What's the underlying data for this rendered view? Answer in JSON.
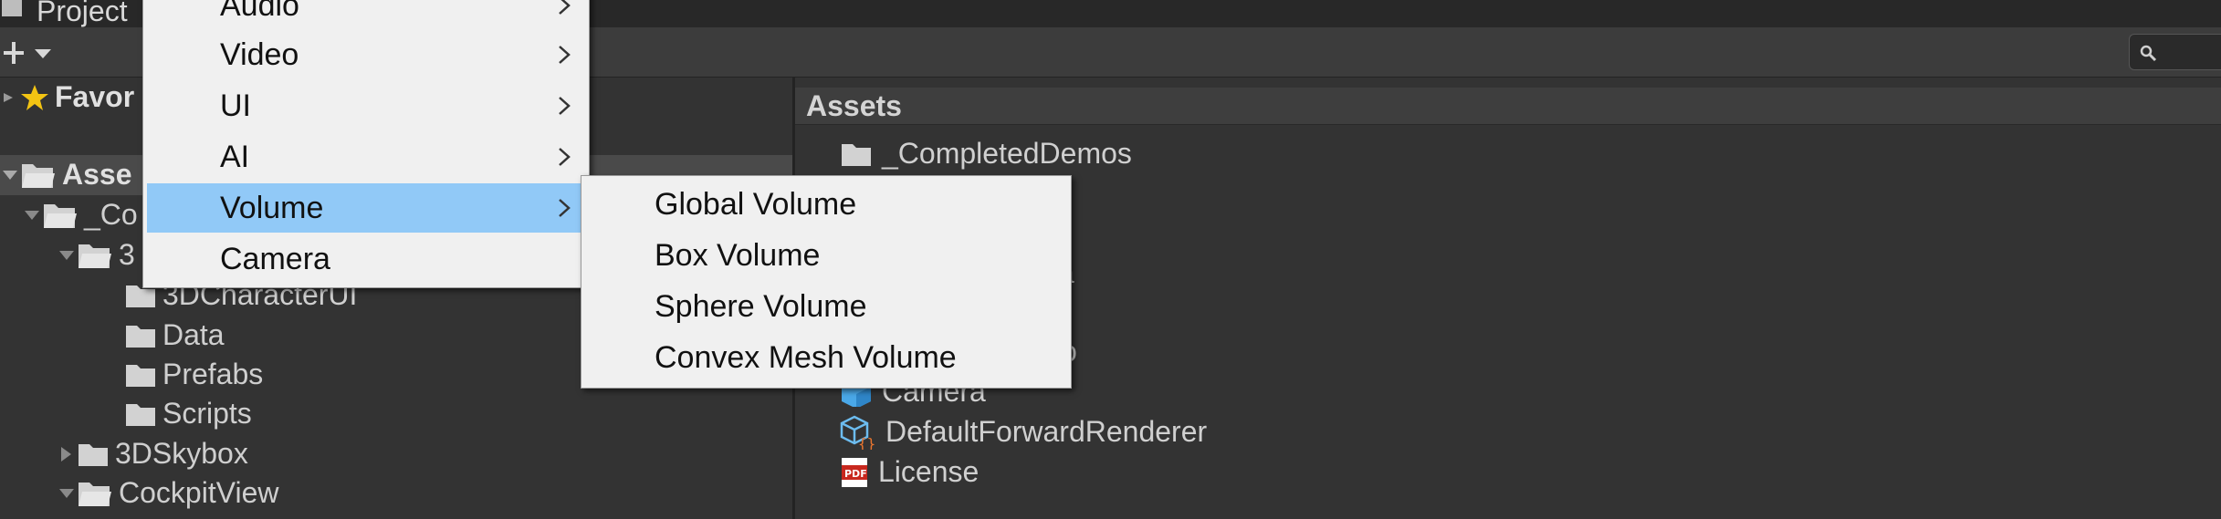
{
  "window": {
    "tab_title": "Project"
  },
  "project_tree": {
    "favorites_label": "Favor",
    "items": [
      {
        "label": "Asse"
      },
      {
        "label": "_Co"
      },
      {
        "label": "3"
      },
      {
        "label": "3DCharacterUI"
      },
      {
        "label": "Data"
      },
      {
        "label": "Prefabs"
      },
      {
        "label": "Scripts"
      },
      {
        "label": "3DSkybox"
      },
      {
        "label": "CockpitView"
      }
    ]
  },
  "assets_pane": {
    "header": "Assets",
    "items": [
      {
        "label": "_CompletedDemos",
        "icon": "folder-icon"
      },
      {
        "label": "ts",
        "icon": "folder-icon"
      },
      {
        "label": "ta",
        "icon": "folder-icon"
      },
      {
        "label": "o",
        "icon": "folder-icon"
      },
      {
        "label": "Camera",
        "icon": "camera-prefab-icon"
      },
      {
        "label": "DefaultForwardRenderer",
        "icon": "scriptable-object-icon"
      },
      {
        "label": "License",
        "icon": "pdf-icon"
      }
    ]
  },
  "context_menu": {
    "items": [
      {
        "label": "Audio",
        "submenu": true,
        "highlighted": false
      },
      {
        "label": "Video",
        "submenu": true,
        "highlighted": false
      },
      {
        "label": "UI",
        "submenu": true,
        "highlighted": false
      },
      {
        "label": "AI",
        "submenu": true,
        "highlighted": false
      },
      {
        "label": "Volume",
        "submenu": true,
        "highlighted": true
      },
      {
        "label": "Camera",
        "submenu": false,
        "highlighted": false
      }
    ]
  },
  "volume_submenu": {
    "items": [
      {
        "label": "Global Volume"
      },
      {
        "label": "Box Volume"
      },
      {
        "label": "Sphere Volume"
      },
      {
        "label": "Convex Mesh Volume"
      }
    ]
  },
  "colors": {
    "menu_background": "#f0f0f0",
    "menu_highlight": "#91c9f7",
    "editor_background": "#333333",
    "favorites_star": "#f3c413",
    "pdf_red": "#c8281e",
    "prefab_blue": "#4aa8e8"
  }
}
